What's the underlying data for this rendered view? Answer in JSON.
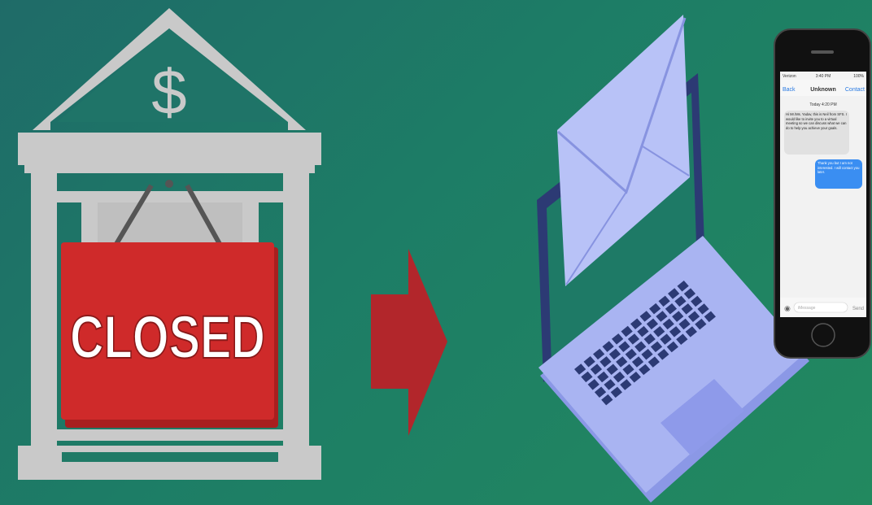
{
  "bank": {
    "symbol": "$",
    "sign_text": "CLOSED"
  },
  "phone": {
    "status_left": "Verizon",
    "status_time": "3:40 PM",
    "status_right": "100%",
    "back_label": "Back",
    "contact_title": "Unknown",
    "contact_link": "Contact",
    "date_label": "Today 4:20 PM",
    "incoming_message": "Hi Mr./Ms. Yadav, this is Neil from SFS. I would like to invite you to a virtual meeting so we can discuss what we can do to help you achieve your goals.",
    "outgoing_message": "Thank you but I am not interested. I will contact you later.",
    "input_placeholder": "iMessage",
    "send_label": "Send"
  },
  "colors": {
    "bank_gray": "#c9c9c9",
    "sign_red": "#cf2a2a",
    "arrow_red": "#b2262b",
    "laptop_light": "#a9b4f2",
    "laptop_dark": "#2c3a74",
    "envelope": "#b8c2f7"
  }
}
